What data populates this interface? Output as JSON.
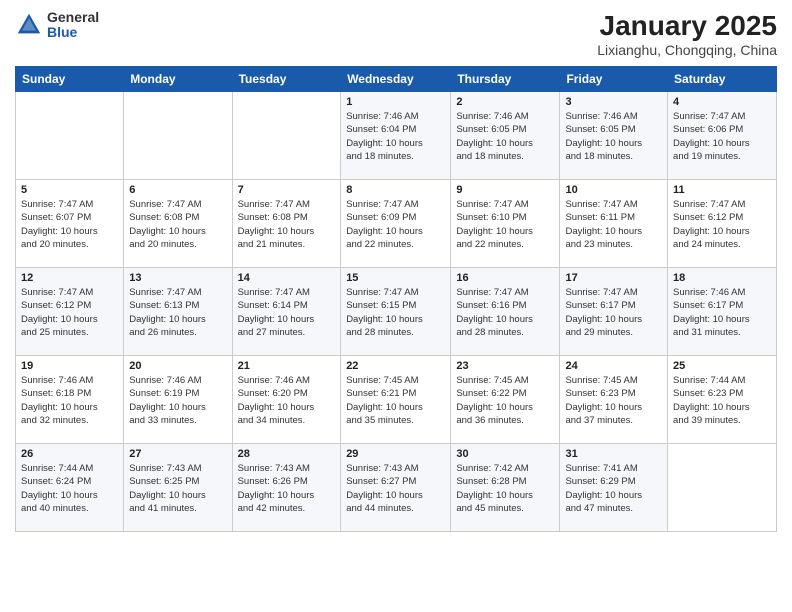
{
  "header": {
    "logo_general": "General",
    "logo_blue": "Blue",
    "title": "January 2025",
    "subtitle": "Lixianghu, Chongqing, China"
  },
  "weekdays": [
    "Sunday",
    "Monday",
    "Tuesday",
    "Wednesday",
    "Thursday",
    "Friday",
    "Saturday"
  ],
  "weeks": [
    [
      {
        "day": "",
        "info": ""
      },
      {
        "day": "",
        "info": ""
      },
      {
        "day": "",
        "info": ""
      },
      {
        "day": "1",
        "info": "Sunrise: 7:46 AM\nSunset: 6:04 PM\nDaylight: 10 hours\nand 18 minutes."
      },
      {
        "day": "2",
        "info": "Sunrise: 7:46 AM\nSunset: 6:05 PM\nDaylight: 10 hours\nand 18 minutes."
      },
      {
        "day": "3",
        "info": "Sunrise: 7:46 AM\nSunset: 6:05 PM\nDaylight: 10 hours\nand 18 minutes."
      },
      {
        "day": "4",
        "info": "Sunrise: 7:47 AM\nSunset: 6:06 PM\nDaylight: 10 hours\nand 19 minutes."
      }
    ],
    [
      {
        "day": "5",
        "info": "Sunrise: 7:47 AM\nSunset: 6:07 PM\nDaylight: 10 hours\nand 20 minutes."
      },
      {
        "day": "6",
        "info": "Sunrise: 7:47 AM\nSunset: 6:08 PM\nDaylight: 10 hours\nand 20 minutes."
      },
      {
        "day": "7",
        "info": "Sunrise: 7:47 AM\nSunset: 6:08 PM\nDaylight: 10 hours\nand 21 minutes."
      },
      {
        "day": "8",
        "info": "Sunrise: 7:47 AM\nSunset: 6:09 PM\nDaylight: 10 hours\nand 22 minutes."
      },
      {
        "day": "9",
        "info": "Sunrise: 7:47 AM\nSunset: 6:10 PM\nDaylight: 10 hours\nand 22 minutes."
      },
      {
        "day": "10",
        "info": "Sunrise: 7:47 AM\nSunset: 6:11 PM\nDaylight: 10 hours\nand 23 minutes."
      },
      {
        "day": "11",
        "info": "Sunrise: 7:47 AM\nSunset: 6:12 PM\nDaylight: 10 hours\nand 24 minutes."
      }
    ],
    [
      {
        "day": "12",
        "info": "Sunrise: 7:47 AM\nSunset: 6:12 PM\nDaylight: 10 hours\nand 25 minutes."
      },
      {
        "day": "13",
        "info": "Sunrise: 7:47 AM\nSunset: 6:13 PM\nDaylight: 10 hours\nand 26 minutes."
      },
      {
        "day": "14",
        "info": "Sunrise: 7:47 AM\nSunset: 6:14 PM\nDaylight: 10 hours\nand 27 minutes."
      },
      {
        "day": "15",
        "info": "Sunrise: 7:47 AM\nSunset: 6:15 PM\nDaylight: 10 hours\nand 28 minutes."
      },
      {
        "day": "16",
        "info": "Sunrise: 7:47 AM\nSunset: 6:16 PM\nDaylight: 10 hours\nand 28 minutes."
      },
      {
        "day": "17",
        "info": "Sunrise: 7:47 AM\nSunset: 6:17 PM\nDaylight: 10 hours\nand 29 minutes."
      },
      {
        "day": "18",
        "info": "Sunrise: 7:46 AM\nSunset: 6:17 PM\nDaylight: 10 hours\nand 31 minutes."
      }
    ],
    [
      {
        "day": "19",
        "info": "Sunrise: 7:46 AM\nSunset: 6:18 PM\nDaylight: 10 hours\nand 32 minutes."
      },
      {
        "day": "20",
        "info": "Sunrise: 7:46 AM\nSunset: 6:19 PM\nDaylight: 10 hours\nand 33 minutes."
      },
      {
        "day": "21",
        "info": "Sunrise: 7:46 AM\nSunset: 6:20 PM\nDaylight: 10 hours\nand 34 minutes."
      },
      {
        "day": "22",
        "info": "Sunrise: 7:45 AM\nSunset: 6:21 PM\nDaylight: 10 hours\nand 35 minutes."
      },
      {
        "day": "23",
        "info": "Sunrise: 7:45 AM\nSunset: 6:22 PM\nDaylight: 10 hours\nand 36 minutes."
      },
      {
        "day": "24",
        "info": "Sunrise: 7:45 AM\nSunset: 6:23 PM\nDaylight: 10 hours\nand 37 minutes."
      },
      {
        "day": "25",
        "info": "Sunrise: 7:44 AM\nSunset: 6:23 PM\nDaylight: 10 hours\nand 39 minutes."
      }
    ],
    [
      {
        "day": "26",
        "info": "Sunrise: 7:44 AM\nSunset: 6:24 PM\nDaylight: 10 hours\nand 40 minutes."
      },
      {
        "day": "27",
        "info": "Sunrise: 7:43 AM\nSunset: 6:25 PM\nDaylight: 10 hours\nand 41 minutes."
      },
      {
        "day": "28",
        "info": "Sunrise: 7:43 AM\nSunset: 6:26 PM\nDaylight: 10 hours\nand 42 minutes."
      },
      {
        "day": "29",
        "info": "Sunrise: 7:43 AM\nSunset: 6:27 PM\nDaylight: 10 hours\nand 44 minutes."
      },
      {
        "day": "30",
        "info": "Sunrise: 7:42 AM\nSunset: 6:28 PM\nDaylight: 10 hours\nand 45 minutes."
      },
      {
        "day": "31",
        "info": "Sunrise: 7:41 AM\nSunset: 6:29 PM\nDaylight: 10 hours\nand 47 minutes."
      },
      {
        "day": "",
        "info": ""
      }
    ]
  ]
}
